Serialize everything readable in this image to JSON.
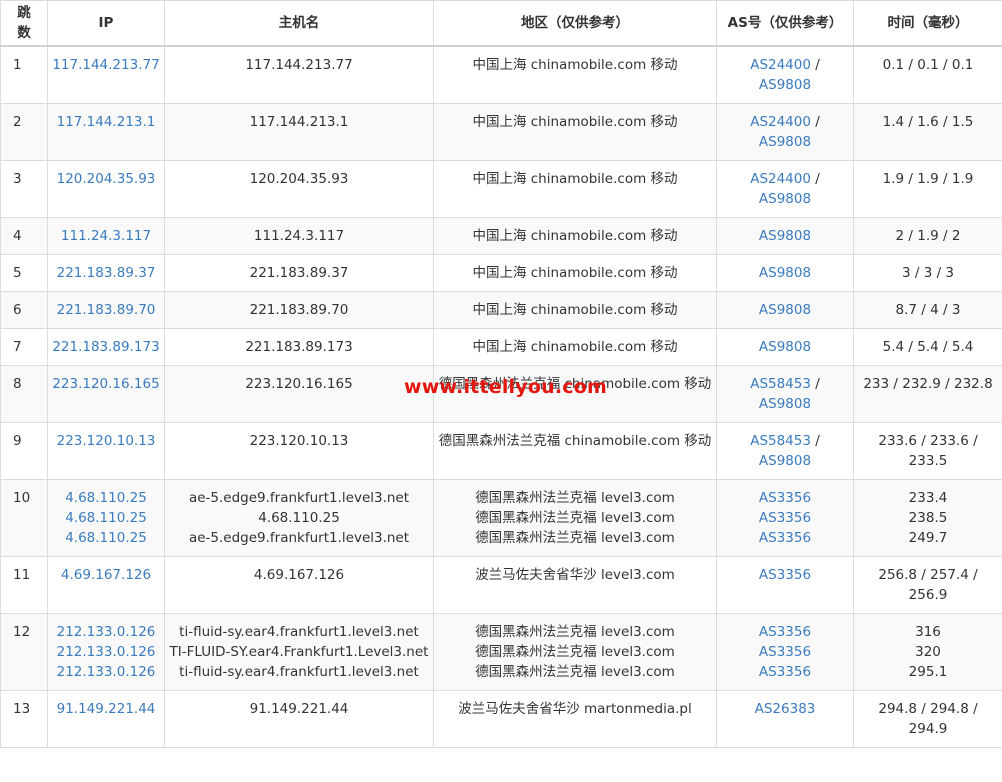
{
  "header": {
    "hop": "跳数",
    "ip": "IP",
    "hostname": "主机名",
    "region": "地区（仅供参考）",
    "asn": "AS号（仅供参考）",
    "time": "时间（毫秒）"
  },
  "watermark": "www.ittellyou.com",
  "rows": [
    {
      "hop": "1",
      "ips": [
        "117.144.213.77"
      ],
      "hosts": [
        "117.144.213.77"
      ],
      "regions": [
        "中国上海 chinamobile.com 移动"
      ],
      "asns": [
        "AS24400",
        "AS9808"
      ],
      "asn_sep": " / ",
      "times": [
        "0.1 / 0.1 / 0.1"
      ]
    },
    {
      "hop": "2",
      "ips": [
        "117.144.213.1"
      ],
      "hosts": [
        "117.144.213.1"
      ],
      "regions": [
        "中国上海 chinamobile.com 移动"
      ],
      "asns": [
        "AS24400",
        "AS9808"
      ],
      "asn_sep": " / ",
      "times": [
        "1.4 / 1.6 / 1.5"
      ]
    },
    {
      "hop": "3",
      "ips": [
        "120.204.35.93"
      ],
      "hosts": [
        "120.204.35.93"
      ],
      "regions": [
        "中国上海 chinamobile.com 移动"
      ],
      "asns": [
        "AS24400",
        "AS9808"
      ],
      "asn_sep": " / ",
      "times": [
        "1.9 / 1.9 / 1.9"
      ]
    },
    {
      "hop": "4",
      "ips": [
        "111.24.3.117"
      ],
      "hosts": [
        "111.24.3.117"
      ],
      "regions": [
        "中国上海 chinamobile.com 移动"
      ],
      "asns": [
        "AS9808"
      ],
      "asn_sep": "",
      "times": [
        "2 / 1.9 / 2"
      ]
    },
    {
      "hop": "5",
      "ips": [
        "221.183.89.37"
      ],
      "hosts": [
        "221.183.89.37"
      ],
      "regions": [
        "中国上海 chinamobile.com 移动"
      ],
      "asns": [
        "AS9808"
      ],
      "asn_sep": "",
      "times": [
        "3 / 3 / 3"
      ]
    },
    {
      "hop": "6",
      "ips": [
        "221.183.89.70"
      ],
      "hosts": [
        "221.183.89.70"
      ],
      "regions": [
        "中国上海 chinamobile.com 移动"
      ],
      "asns": [
        "AS9808"
      ],
      "asn_sep": "",
      "times": [
        "8.7 / 4 / 3"
      ]
    },
    {
      "hop": "7",
      "ips": [
        "221.183.89.173"
      ],
      "hosts": [
        "221.183.89.173"
      ],
      "regions": [
        "中国上海 chinamobile.com 移动"
      ],
      "asns": [
        "AS9808"
      ],
      "asn_sep": "",
      "times": [
        "5.4 / 5.4 / 5.4"
      ]
    },
    {
      "hop": "8",
      "ips": [
        "223.120.16.165"
      ],
      "hosts": [
        "223.120.16.165"
      ],
      "regions": [
        "德国黑森州法兰克福 chinamobile.com 移动"
      ],
      "asns": [
        "AS58453",
        "AS9808"
      ],
      "asn_sep": " / ",
      "times": [
        "233 / 232.9 / 232.8"
      ]
    },
    {
      "hop": "9",
      "ips": [
        "223.120.10.13"
      ],
      "hosts": [
        "223.120.10.13"
      ],
      "regions": [
        "德国黑森州法兰克福 chinamobile.com 移动"
      ],
      "asns": [
        "AS58453",
        "AS9808"
      ],
      "asn_sep": " / ",
      "times": [
        "233.6 / 233.6 / 233.5"
      ]
    },
    {
      "hop": "10",
      "ips": [
        "4.68.110.25",
        "4.68.110.25",
        "4.68.110.25"
      ],
      "hosts": [
        "ae-5.edge9.frankfurt1.level3.net",
        "4.68.110.25",
        "ae-5.edge9.frankfurt1.level3.net"
      ],
      "regions": [
        "德国黑森州法兰克福 level3.com",
        "德国黑森州法兰克福 level3.com",
        "德国黑森州法兰克福 level3.com"
      ],
      "asns": [
        "AS3356",
        "AS3356",
        "AS3356"
      ],
      "asn_sep": "",
      "times": [
        "233.4",
        "238.5",
        "249.7"
      ]
    },
    {
      "hop": "11",
      "ips": [
        "4.69.167.126"
      ],
      "hosts": [
        "4.69.167.126"
      ],
      "regions": [
        "波兰马佐夫舍省华沙 level3.com"
      ],
      "asns": [
        "AS3356"
      ],
      "asn_sep": "",
      "times": [
        "256.8 / 257.4 / 256.9"
      ]
    },
    {
      "hop": "12",
      "ips": [
        "212.133.0.126",
        "212.133.0.126",
        "212.133.0.126"
      ],
      "hosts": [
        "ti-fluid-sy.ear4.frankfurt1.level3.net",
        "TI-FLUID-SY.ear4.Frankfurt1.Level3.net",
        "ti-fluid-sy.ear4.frankfurt1.level3.net"
      ],
      "regions": [
        "德国黑森州法兰克福 level3.com",
        "德国黑森州法兰克福 level3.com",
        "德国黑森州法兰克福 level3.com"
      ],
      "asns": [
        "AS3356",
        "AS3356",
        "AS3356"
      ],
      "asn_sep": "",
      "times": [
        "316",
        "320",
        "295.1"
      ]
    },
    {
      "hop": "13",
      "ips": [
        "91.149.221.44"
      ],
      "hosts": [
        "91.149.221.44"
      ],
      "regions": [
        "波兰马佐夫舍省华沙 martonmedia.pl"
      ],
      "asns": [
        "AS26383"
      ],
      "asn_sep": "",
      "times": [
        "294.8 / 294.8 / 294.9"
      ]
    }
  ]
}
